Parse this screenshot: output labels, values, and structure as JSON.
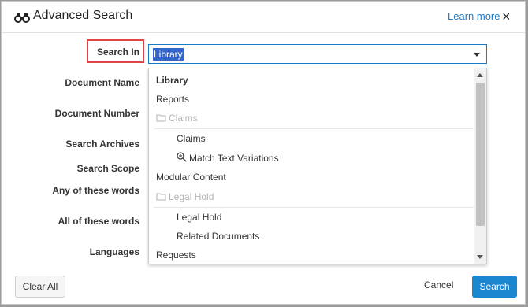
{
  "header": {
    "title": "Advanced Search",
    "title_icon": "binoculars-icon",
    "learn_more": "Learn more",
    "close_glyph": "×"
  },
  "form": {
    "labels": {
      "search_in": "Search In",
      "document_name": "Document Name",
      "document_number": "Document Number",
      "search_archives": "Search Archives",
      "search_scope": "Search Scope",
      "any_words": "Any of these words",
      "all_words": "All of these words",
      "languages": "Languages"
    },
    "search_in_value": "Library"
  },
  "dropdown": {
    "options": [
      {
        "label": "Library",
        "style": "selected"
      },
      {
        "label": "Reports",
        "style": "normal"
      },
      {
        "label": "Claims",
        "style": "group-header",
        "icon": "folder-icon"
      },
      {
        "label": "Claims",
        "style": "indented"
      },
      {
        "label": "Match Text Variations",
        "style": "indented",
        "icon": "zoom-in-icon"
      },
      {
        "label": "Modular Content",
        "style": "normal"
      },
      {
        "label": "Legal Hold",
        "style": "group-header",
        "icon": "folder-icon"
      },
      {
        "label": "Legal Hold",
        "style": "indented"
      },
      {
        "label": "Related Documents",
        "style": "indented"
      },
      {
        "label": "Requests",
        "style": "normal"
      }
    ]
  },
  "footer": {
    "clear_all": "Clear All",
    "cancel": "Cancel",
    "search": "Search"
  },
  "colors": {
    "accent": "#1a86d0",
    "link": "#1a7ac8",
    "highlight_border": "#e04646",
    "selection": "#3366cc"
  }
}
